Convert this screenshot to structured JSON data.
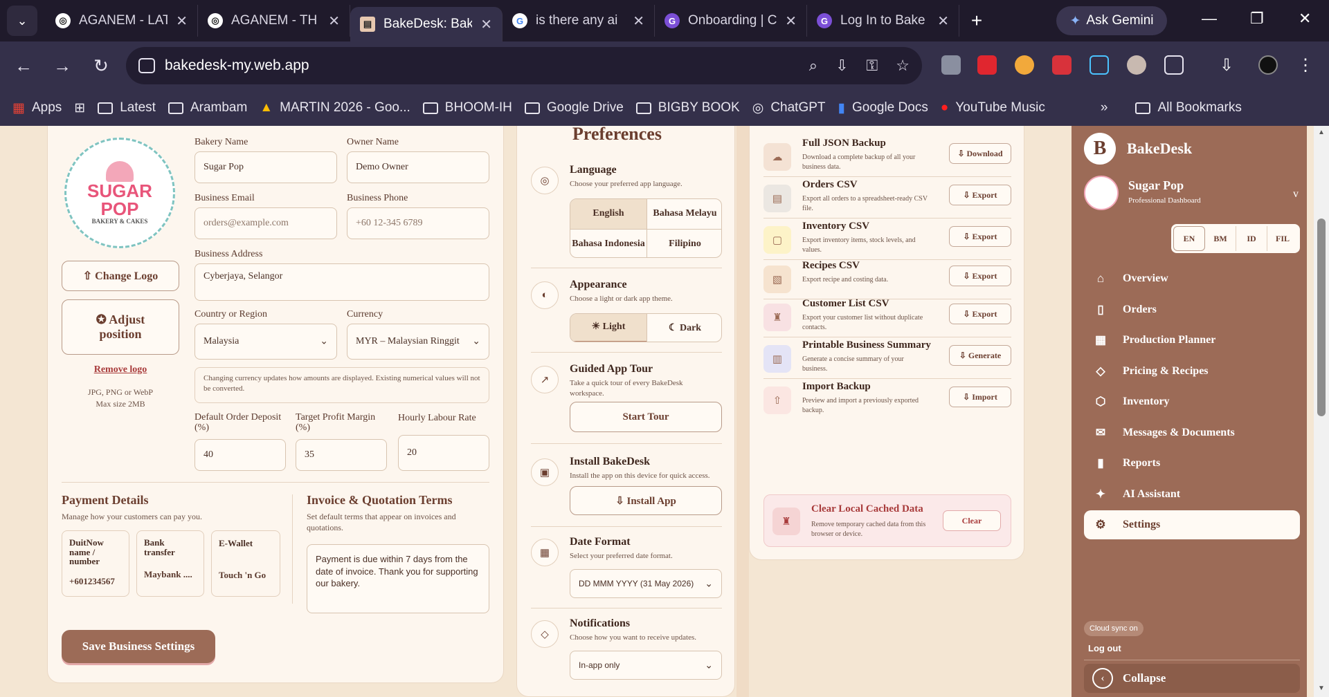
{
  "browser": {
    "tabs": [
      {
        "title": "AGANEM - LAT",
        "favicon": "chatgpt-icon"
      },
      {
        "title": "AGANEM - TH",
        "favicon": "chatgpt-icon"
      },
      {
        "title": "BakeDesk: Bak",
        "favicon": "bakedesk-icon"
      },
      {
        "title": "is there any ai",
        "favicon": "google-icon"
      },
      {
        "title": "Onboarding | C",
        "favicon": "claude-icon"
      },
      {
        "title": "Log In to Bake",
        "favicon": "claude-icon"
      }
    ],
    "gemini_label": "Ask Gemini",
    "url": "bakedesk-my.web.app",
    "bookmarks": [
      "Apps",
      "Latest",
      "Arambam",
      "MARTIN 2026 - Goo...",
      "BHOOM-IH",
      "Google Drive",
      "BIGBY BOOK",
      "ChatGPT",
      "Google Docs",
      "YouTube Music"
    ],
    "all_bookmarks": "All Bookmarks",
    "more": "»"
  },
  "business": {
    "logo_text": "SUGAR POP",
    "logo_sub": "BAKERY & CAKES",
    "bakery_name_label": "Bakery Name",
    "bakery_name": "Sugar Pop",
    "owner_name_label": "Owner Name",
    "owner_name": "Demo Owner",
    "email_label": "Business Email",
    "email_placeholder": "orders@example.com",
    "phone_label": "Business Phone",
    "phone_placeholder": "+60 12-345 6789",
    "address_label": "Business Address",
    "address": "Cyberjaya, Selangor",
    "country_label": "Country or Region",
    "country": "Malaysia",
    "currency_label": "Currency",
    "currency": "MYR – Malaysian Ringgit",
    "currency_note": "Changing currency updates how amounts are displayed. Existing numerical values will not be converted.",
    "deposit_label": "Default Order Deposit (%)",
    "deposit": "40",
    "margin_label": "Target Profit Margin (%)",
    "margin": "35",
    "labour_label": "Hourly Labour Rate",
    "labour": "20",
    "change_logo": "⇧ Change Logo",
    "adjust_position": "✪ Adjust position",
    "remove_logo": "Remove logo",
    "logo_hint": "JPG, PNG or WebP\nMax size 2MB",
    "payment_title": "Payment Details",
    "payment_sub": "Manage how your customers can pay you.",
    "payments": [
      {
        "title": "DuitNow name / number",
        "value": "+601234567"
      },
      {
        "title": "Bank transfer",
        "value": "Maybank ...."
      },
      {
        "title": "E-Wallet",
        "value": "Touch 'n Go"
      }
    ],
    "invoice_title": "Invoice & Quotation Terms",
    "invoice_sub": "Set default terms that appear on invoices and quotations.",
    "invoice_terms": "Payment is due within 7 days from the date of invoice. Thank you for supporting our bakery.",
    "save_button": "Save Business Settings"
  },
  "preferences": {
    "title": "Preferences",
    "language_title": "Language",
    "language_sub": "Choose your preferred app language.",
    "languages": [
      "English",
      "Bahasa Melayu",
      "Bahasa Indonesia",
      "Filipino"
    ],
    "appearance_title": "Appearance",
    "appearance_sub": "Choose a light or dark app theme.",
    "light": "☀ Light",
    "dark": "☾ Dark",
    "tour_title": "Guided App Tour",
    "tour_sub": "Take a quick tour of every BakeDesk workspace.",
    "tour_button": "Start Tour",
    "install_title": "Install BakeDesk",
    "install_sub": "Install the app on this device for quick access.",
    "install_button": "⇩ Install App",
    "date_title": "Date Format",
    "date_sub": "Select your preferred date format.",
    "date_value": "DD MMM YYYY (31 May 2026)",
    "notif_title": "Notifications",
    "notif_sub": "Choose how you want to receive updates.",
    "notif_value": "In-app only"
  },
  "exports": [
    {
      "title": "Full JSON Backup",
      "sub": "Download a complete backup of all your business data.",
      "button": "⇩ Download",
      "icon": "cloud-icon"
    },
    {
      "title": "Orders CSV",
      "sub": "Export all orders to a spreadsheet-ready CSV file.",
      "button": "⇩ Export",
      "icon": "orders-icon"
    },
    {
      "title": "Inventory CSV",
      "sub": "Export inventory items, stock levels, and values.",
      "button": "⇩ Export",
      "icon": "inventory-icon"
    },
    {
      "title": "Recipes CSV",
      "sub": "Export recipe and costing data.",
      "button": "⇩ Export",
      "icon": "recipes-icon"
    },
    {
      "title": "Customer List CSV",
      "sub": "Export your customer list without duplicate contacts.",
      "button": "⇩ Export",
      "icon": "customer-icon"
    },
    {
      "title": "Printable Business Summary",
      "sub": "Generate a concise summary of your business.",
      "button": "⇩ Generate",
      "icon": "summary-icon"
    },
    {
      "title": "Import Backup",
      "sub": "Preview and import a previously exported backup.",
      "button": "⇩ Import",
      "icon": "import-icon"
    }
  ],
  "clear": {
    "title": "Clear Local Cached Data",
    "sub": "Remove temporary cached data from this browser or device.",
    "button": "Clear"
  },
  "sidebar": {
    "brand": "BakeDesk",
    "brand_initial": "B",
    "shop_name": "Sugar Pop",
    "shop_sub": "Professional Dashboard",
    "chevron": "v",
    "langs": [
      "EN",
      "BM",
      "ID",
      "FIL"
    ],
    "items": [
      {
        "label": "Overview",
        "icon": "home-icon"
      },
      {
        "label": "Orders",
        "icon": "bag-icon"
      },
      {
        "label": "Production Planner",
        "icon": "calendar-icon"
      },
      {
        "label": "Pricing & Recipes",
        "icon": "tag-icon"
      },
      {
        "label": "Inventory",
        "icon": "box-icon"
      },
      {
        "label": "Messages & Documents",
        "icon": "mail-icon"
      },
      {
        "label": "Reports",
        "icon": "chart-icon"
      },
      {
        "label": "AI Assistant",
        "icon": "sparkle-icon"
      },
      {
        "label": "Settings",
        "icon": "gear-icon"
      }
    ],
    "cloud_sync": "Cloud sync on",
    "logout": "Log out",
    "collapse": "Collapse"
  }
}
